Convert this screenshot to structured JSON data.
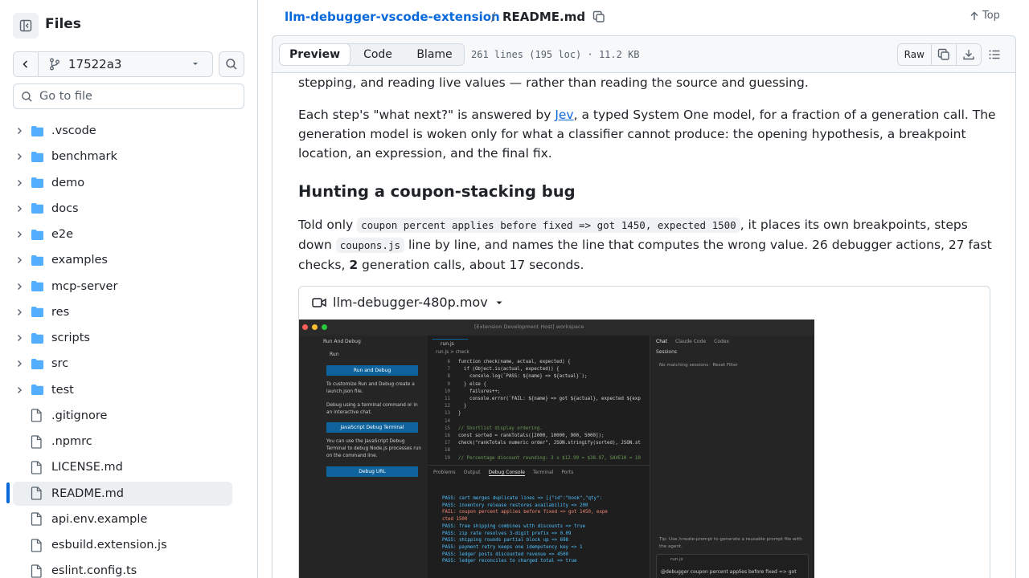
{
  "sidebar": {
    "title": "Files",
    "branch": "17522a3",
    "goto_placeholder": "Go to file",
    "tree": [
      {
        "name": ".vscode",
        "type": "folder"
      },
      {
        "name": "benchmark",
        "type": "folder"
      },
      {
        "name": "demo",
        "type": "folder"
      },
      {
        "name": "docs",
        "type": "folder"
      },
      {
        "name": "e2e",
        "type": "folder"
      },
      {
        "name": "examples",
        "type": "folder"
      },
      {
        "name": "mcp-server",
        "type": "folder"
      },
      {
        "name": "res",
        "type": "folder"
      },
      {
        "name": "scripts",
        "type": "folder"
      },
      {
        "name": "src",
        "type": "folder"
      },
      {
        "name": "test",
        "type": "folder"
      },
      {
        "name": ".gitignore",
        "type": "file"
      },
      {
        "name": ".npmrc",
        "type": "file"
      },
      {
        "name": "LICENSE.md",
        "type": "file"
      },
      {
        "name": "README.md",
        "type": "file",
        "selected": true
      },
      {
        "name": "api.env.example",
        "type": "file"
      },
      {
        "name": "esbuild.extension.js",
        "type": "file"
      },
      {
        "name": "eslint.config.ts",
        "type": "file"
      }
    ]
  },
  "breadcrumb": {
    "repo": "llm-debugger-vscode-extension",
    "separator": "/",
    "file": "README.md",
    "top_label": "Top"
  },
  "filebar": {
    "tabs": [
      "Preview",
      "Code",
      "Blame"
    ],
    "active_tab": "Preview",
    "meta": "261 lines (195 loc) · 11.2 KB",
    "raw_label": "Raw"
  },
  "readme": {
    "para0": "stepping, and reading live values — rather than reading the source and guessing.",
    "para1_before": "Each step's \"what next?\" is answered by ",
    "para1_link": "Jev",
    "para1_after": ", a typed System One model, for a fraction of a generation call. The generation model is woken only for what a classifier cannot produce: the opening hypothesis, a breakpoint location, an expression, and the final fix.",
    "heading": "Hunting a coupon-stacking bug",
    "para2_a": "Told only ",
    "para2_code1": "coupon percent applies before fixed => got 1450, expected 1500",
    "para2_b": ", it places its own breakpoints, steps down ",
    "para2_code2": "coupons.js",
    "para2_c": " line by line, and names the line that computes the wrong value. 26 debugger actions, 27 fast checks, ",
    "para2_bold": "2",
    "para2_d": " generation calls, about 17 seconds.",
    "video_name": "llm-debugger-480p.mov"
  },
  "video": {
    "title": "[Extension Development Host] workspace",
    "run_debug": "Run And Debug",
    "run": "Run",
    "run_debug_btn": "Run and Debug",
    "customize": "To customize Run and Debug create a launch.json file.",
    "debug_terminal_text": "Debug using a terminal command or in an interactive chat.",
    "js_debug_btn": "JavaScript Debug Terminal",
    "js_debug_text": "You can use the JavaScript Debug Terminal to debug Node.js processes run on the command line.",
    "debug_url_btn": "Debug URL",
    "tab_file": "run.js",
    "crumb": "run.js > check",
    "code_lines": [
      "function check(name, actual, expected) {",
      "  if (Object.is(actual, expected)) {",
      "    console.log(`PASS: ${name} => ${actual}`);",
      "  } else {",
      "    failures++;",
      "    console.error(`FAIL: ${name} => got ${actual}, expected ${exp",
      "  }",
      "}",
      "",
      "// Shortlist display ordering.",
      "const sorted = rankTotals([2000, 10000, 900, 5000]);",
      "check(\"rankTotals numeric order\", JSON.stringify(sorted), JSON.st",
      "",
      "// Percentage discount rounding: 3 x $12.99 = $38.97, SAVE10 = 10"
    ],
    "line_start": 6,
    "panel_tabs": [
      "Problems",
      "Output",
      "Debug Console",
      "Terminal",
      "Ports"
    ],
    "console_lines": [
      {
        "text": "PASS: cart merges duplicate lines => [{\"id\":\"book\",\"qty\":",
        "kind": "pass"
      },
      {
        "text": "PASS: inventory release restores availability => 200",
        "kind": "pass"
      },
      {
        "text": "FAIL: coupon percent applies before fixed => got 1450, expe",
        "kind": "fail"
      },
      {
        "text": "cted 1500",
        "kind": "fail"
      },
      {
        "text": "PASS: free shipping combines with discounts => true",
        "kind": "pass"
      },
      {
        "text": "PASS: zip rate resolves 3-digit prefix => 0.09",
        "kind": "pass"
      },
      {
        "text": "PASS: shipping rounds partial block up => 698",
        "kind": "pass"
      },
      {
        "text": "PASS: payment retry keeps one idempotency key => 1",
        "kind": "pass"
      },
      {
        "text": "PASS: ledger posts discounted revenue => 4500",
        "kind": "pass"
      },
      {
        "text": "PASS: ledger reconciles to charged total => true",
        "kind": "pass"
      }
    ],
    "chat_tabs": [
      "Chat",
      "Claude Code",
      "Codex"
    ],
    "sessions": "Sessions",
    "no_sessions": "No matching sessions · Reset Filter",
    "tip": "Tip: Use /create-prompt to generate a reusable prompt file with the agent.",
    "chat_file": "run.js",
    "chat_input": "@debugger coupon percent applies before fixed => got"
  },
  "colors": {
    "accent": "#0969da",
    "folder": "#54aeff",
    "border": "#d1d9e0"
  }
}
